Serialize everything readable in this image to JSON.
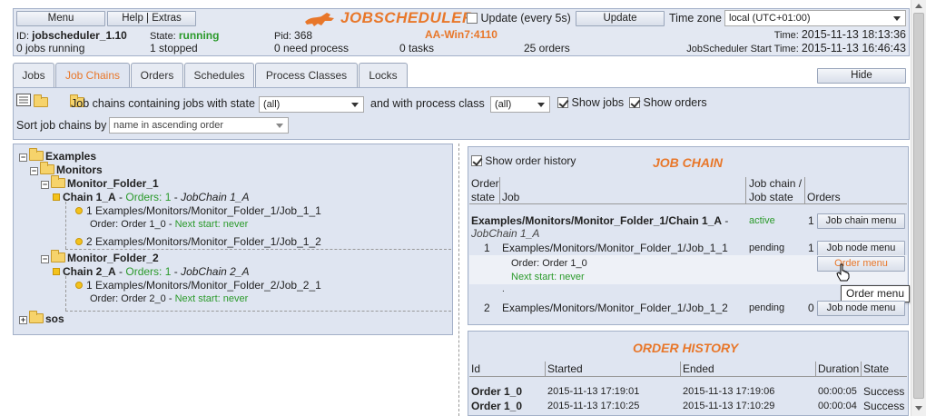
{
  "header": {
    "menu_label": "Menu",
    "help_label": "Help | Extras",
    "logo_text": "JOBSCHEDULER",
    "update_every_label": "Update (every 5s)",
    "update_button": "Update",
    "timezone_label": "Time zone",
    "timezone_value": "local (UTC+01:00)",
    "id_label": "ID:",
    "id_value": "jobscheduler_1.10",
    "state_label": "State:",
    "state_value": "running",
    "pid_label": "Pid:",
    "pid_value": "368",
    "host": "AA-Win7:4110",
    "time_label": "Time:",
    "time_value": "2015-11-13 18:13:36",
    "jobs_running": "0 jobs running",
    "stopped": "1 stopped",
    "need_process": "0 need process",
    "tasks": "0 tasks",
    "orders": "25 orders",
    "start_time_label": "JobScheduler Start Time:",
    "start_time_value": "2015-11-13 16:46:43"
  },
  "tabs": [
    "Jobs",
    "Job Chains",
    "Orders",
    "Schedules",
    "Process Classes",
    "Locks"
  ],
  "hide_label": "Hide",
  "filter": {
    "state_label": "Job chains containing jobs with state",
    "state_value": "(all)",
    "process_class_label": "and with process class",
    "process_class_value": "(all)",
    "show_jobs": "Show jobs",
    "show_orders": "Show orders",
    "sort_label": "Sort job chains by",
    "sort_value": "name in ascending order"
  },
  "tree": {
    "examples": "Examples",
    "monitors": "Monitors",
    "folder1": "Monitor_Folder_1",
    "chain1": "Chain 1_A",
    "chain1_orders": "Orders: 1",
    "chain1_title": "JobChain 1_A",
    "chain1_job1": "1 Examples/Monitors/Monitor_Folder_1/Job_1_1",
    "chain1_order": "Order: Order 1_0",
    "chain1_next": "Next start: never",
    "chain1_job2": "2 Examples/Monitors/Monitor_Folder_1/Job_1_2",
    "folder2": "Monitor_Folder_2",
    "chain2": "Chain 2_A",
    "chain2_orders": "Orders: 1",
    "chain2_title": "JobChain 2_A",
    "chain2_job1": "1 Examples/Monitors/Monitor_Folder_2/Job_2_1",
    "chain2_order": "Order: Order 2_0",
    "chain2_next": "Next start: never",
    "sos": "sos",
    "sep": "-"
  },
  "job_chain": {
    "show_history": "Show order history",
    "title": "JOB CHAIN",
    "col_order": "Order",
    "col_state": "state",
    "col_job": "Job",
    "col_chain1": "Job chain /",
    "col_chain2": "Job state",
    "col_orders": "Orders",
    "chain_path": "Examples/Monitors/Monitor_Folder_1/Chain 1_A",
    "chain_dash": " - ",
    "chain_title": "JobChain 1_A",
    "chain_status": "active",
    "chain_orders": "1",
    "chain_menu": "Job chain menu",
    "node1_state": "1",
    "node1_job": "Examples/Monitors/Monitor_Folder_1/Job_1_1",
    "node1_status": "pending",
    "node1_orders": "1",
    "node_menu": "Job node menu",
    "order_label": "Order: Order 1_0",
    "order_next": "Next start: never",
    "order_menu": "Order menu",
    "dot": ".",
    "node2_state": "2",
    "node2_job": "Examples/Monitors/Monitor_Folder_1/Job_1_2",
    "node2_status": "pending",
    "node2_orders": "0",
    "tooltip": "Order menu"
  },
  "history": {
    "title": "ORDER HISTORY",
    "col_id": "Id",
    "col_started": "Started",
    "col_ended": "Ended",
    "col_duration": "Duration",
    "col_state": "State",
    "rows": [
      {
        "id": "Order 1_0",
        "started": "2015-11-13 17:19:01",
        "ended": "2015-11-13 17:19:06",
        "duration": "00:00:05",
        "state": "Success"
      },
      {
        "id": "Order 1_0",
        "started": "2015-11-13 17:10:25",
        "ended": "2015-11-13 17:10:29",
        "duration": "00:00:04",
        "state": "Success"
      }
    ]
  },
  "colors": {
    "accent": "#e8772a",
    "green": "#2b9a2b",
    "panel": "#dfe5f1"
  }
}
